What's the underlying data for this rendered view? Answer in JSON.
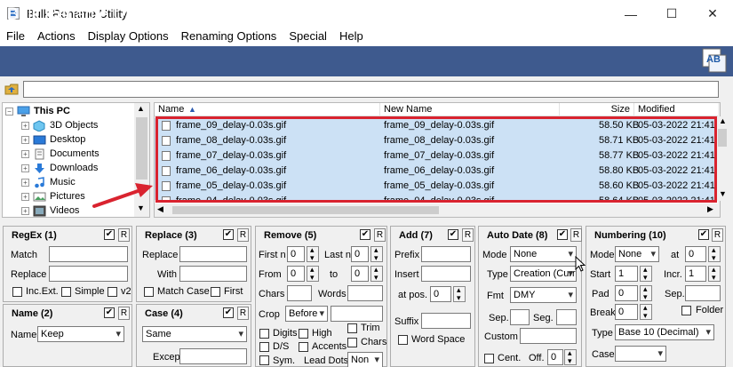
{
  "window": {
    "title": "Bulk Rename Utility",
    "minimize": "—",
    "maximize": "☐",
    "close": "✕"
  },
  "menu": [
    "File",
    "Actions",
    "Display Options",
    "Renaming Options",
    "Special",
    "Help"
  ],
  "banner": {
    "title": "Bulk Rename Utility",
    "logo_text": "AB"
  },
  "path": {
    "value": ""
  },
  "tree": {
    "root": "This PC",
    "items": [
      "3D Objects",
      "Desktop",
      "Documents",
      "Downloads",
      "Music",
      "Pictures",
      "Videos"
    ]
  },
  "filelist": {
    "headers": {
      "name": "Name",
      "new_name": "New Name",
      "size": "Size",
      "modified": "Modified"
    },
    "rows": [
      {
        "name": "frame_09_delay-0.03s.gif",
        "new_name": "frame_09_delay-0.03s.gif",
        "size": "58.50 KB",
        "modified": "05-03-2022 21:41:02"
      },
      {
        "name": "frame_08_delay-0.03s.gif",
        "new_name": "frame_08_delay-0.03s.gif",
        "size": "58.71 KB",
        "modified": "05-03-2022 21:41:02"
      },
      {
        "name": "frame_07_delay-0.03s.gif",
        "new_name": "frame_07_delay-0.03s.gif",
        "size": "58.77 KB",
        "modified": "05-03-2022 21:41:02"
      },
      {
        "name": "frame_06_delay-0.03s.gif",
        "new_name": "frame_06_delay-0.03s.gif",
        "size": "58.80 KB",
        "modified": "05-03-2022 21:41:02"
      },
      {
        "name": "frame_05_delay-0.03s.gif",
        "new_name": "frame_05_delay-0.03s.gif",
        "size": "58.60 KB",
        "modified": "05-03-2022 21:41:02"
      },
      {
        "name": "frame_04_delay-0.03s.gif",
        "new_name": "frame_04_delay-0.03s.gif",
        "size": "58.64 KB",
        "modified": "05-03-2022 21:41:02"
      }
    ]
  },
  "panels": {
    "regex": {
      "title": "RegEx (1)",
      "match": "Match",
      "replace": "Replace",
      "inc_ext": "Inc.Ext.",
      "simple": "Simple",
      "v2": "v2",
      "r": "R"
    },
    "name": {
      "title": "Name (2)",
      "name_label": "Name",
      "name_value": "Keep",
      "r": "R"
    },
    "replace": {
      "title": "Replace (3)",
      "replace": "Replace",
      "with": "With",
      "match_case": "Match Case",
      "first": "First",
      "r": "R"
    },
    "case": {
      "title": "Case (4)",
      "case_value": "Same",
      "except": "Excep.",
      "r": "R"
    },
    "remove": {
      "title": "Remove (5)",
      "first_n": "First n",
      "first_n_val": "0",
      "last_n": "Last n",
      "last_n_val": "0",
      "from": "From",
      "from_val": "0",
      "to": "to",
      "to_val": "0",
      "chars": "Chars",
      "words": "Words",
      "crop": "Crop",
      "crop_val": "Before",
      "digits": "Digits",
      "high": "High",
      "ds": "D/S",
      "accents": "Accents",
      "sym": "Sym.",
      "lead_dots": "Lead Dots",
      "lead_dots_val": "Non",
      "trim": "Trim",
      "chars2": "Chars",
      "r": "R"
    },
    "add": {
      "title": "Add (7)",
      "prefix": "Prefix",
      "insert": "Insert",
      "at_pos": "at pos.",
      "at_pos_val": "0",
      "suffix": "Suffix",
      "word_space": "Word Space",
      "r": "R"
    },
    "autodate": {
      "title": "Auto Date (8)",
      "mode": "Mode",
      "mode_val": "None",
      "type": "Type",
      "type_val": "Creation (Curr",
      "fmt": "Fmt",
      "fmt_val": "DMY",
      "sep": "Sep.",
      "seg": "Seg.",
      "custom": "Custom",
      "cent": "Cent.",
      "off": "Off.",
      "off_val": "0",
      "r": "R"
    },
    "numbering": {
      "title": "Numbering (10)",
      "mode": "Mode",
      "mode_val": "None",
      "at": "at",
      "at_val": "0",
      "start": "Start",
      "start_val": "1",
      "incr": "Incr.",
      "incr_val": "1",
      "pad": "Pad",
      "pad_val": "0",
      "sep": "Sep.",
      "break": "Break",
      "break_val": "0",
      "folder": "Folder",
      "type": "Type",
      "type_val": "Base 10 (Decimal)",
      "case": "Case",
      "r": "R"
    }
  }
}
